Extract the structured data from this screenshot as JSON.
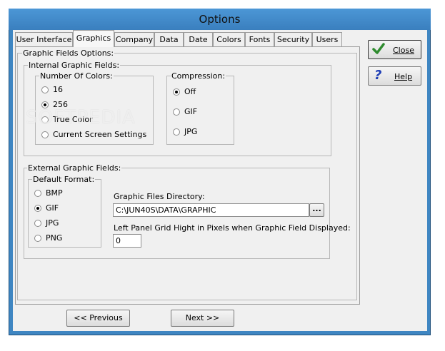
{
  "window": {
    "title": "Options"
  },
  "tabs": [
    {
      "label": "User Interface"
    },
    {
      "label": "Graphics"
    },
    {
      "label": "Company"
    },
    {
      "label": "Data"
    },
    {
      "label": "Date"
    },
    {
      "label": "Colors"
    },
    {
      "label": "Fonts"
    },
    {
      "label": "Security"
    },
    {
      "label": "Users"
    }
  ],
  "active_tab": "Graphics",
  "graphic_fields_options": {
    "label": "Graphic Fields Options:",
    "internal": {
      "label": "Internal Graphic Fields:",
      "colors": {
        "label": "Number Of Colors:",
        "options": [
          "16",
          "256",
          "True Color",
          "Current Screen Settings"
        ],
        "selected": "256"
      },
      "compression": {
        "label": "Compression:",
        "options": [
          "Off",
          "GIF",
          "JPG"
        ],
        "selected": "Off"
      }
    },
    "external": {
      "label": "External Graphic Fields:",
      "default_format": {
        "label": "Default Format:",
        "options": [
          "BMP",
          "GIF",
          "JPG",
          "PNG"
        ],
        "selected": "GIF"
      },
      "directory_label": "Graphic Files Directory:",
      "directory_value": "C:\\JUN40S\\DATA\\GRAPHIC",
      "browse_label": "...",
      "grid_label": "Left Panel Grid Hight in Pixels when Graphic Field Displayed:",
      "grid_value": "0"
    }
  },
  "buttons": {
    "close": "Close",
    "help": "Help",
    "previous": "<< Previous",
    "next": "Next >>"
  },
  "watermark": "SOFTPEDIA",
  "colors": {
    "frame": "#3f86c2",
    "check": "#2e8b2e",
    "help": "#1f3fb5"
  }
}
